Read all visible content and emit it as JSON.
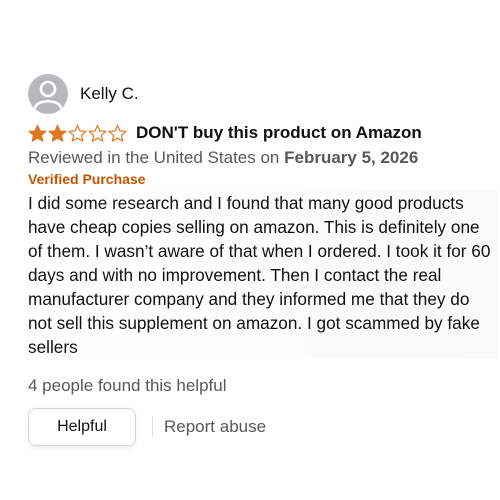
{
  "review": {
    "profile_name": "Kelly C.",
    "avatar_icon": "user-silhouette-icon",
    "rating": 2,
    "rating_max": 5,
    "star_color": "#de7921",
    "title": "DON'T buy this product on Amazon",
    "reviewed_in_prefix": "Reviewed in the United States on",
    "reviewed_date": "February 5, 2026",
    "verified_label": "Verified Purchase",
    "verified_color": "#c45500",
    "body": "I did some research and I found that many good products have cheap copies selling on amazon. This is definitely one of them. I wasn’t aware of that when I ordered. I took it for 60 days and with no improvement. Then I contact the real manufacturer company and they informed me that they do not sell this supplement on amazon. I got scammed by fake sellers",
    "helpful_count_text": "4 people found this helpful",
    "helpful_button_label": "Helpful",
    "report_label": "Report abuse"
  }
}
